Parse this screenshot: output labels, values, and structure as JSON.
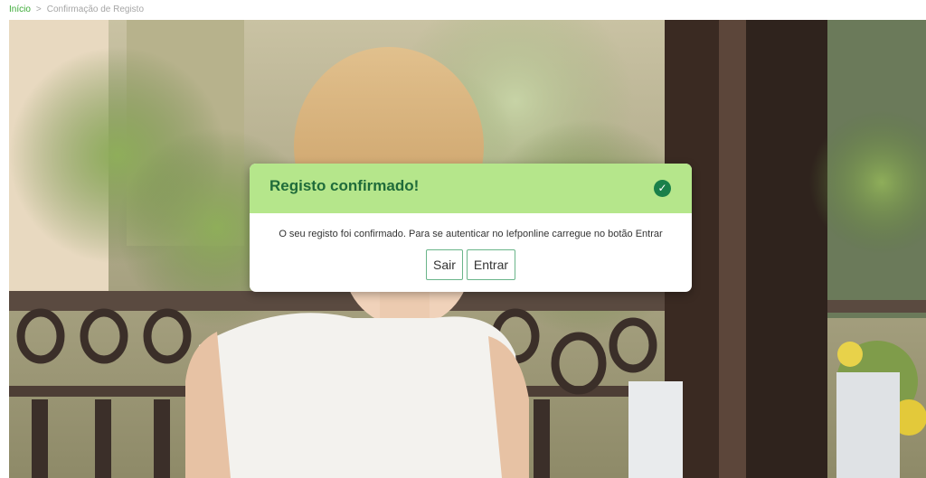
{
  "breadcrumb": {
    "home": "Início",
    "separator": ">",
    "current": "Confirmação de Registo"
  },
  "hero": {
    "description_icon": "photo-woman-laptop-balcony"
  },
  "dialog": {
    "title": "Registo confirmado!",
    "status_icon": "check-circle-icon",
    "message": "O seu registo foi confirmado. Para se autenticar no Iefponline carregue no botão Entrar",
    "buttons": {
      "exit_label": "Sair",
      "login_label": "Entrar"
    }
  },
  "colors": {
    "header_bg": "#b5e68b",
    "title": "#1f6b3a",
    "accent": "#3aaa35",
    "button_border": "#6ab58a"
  }
}
